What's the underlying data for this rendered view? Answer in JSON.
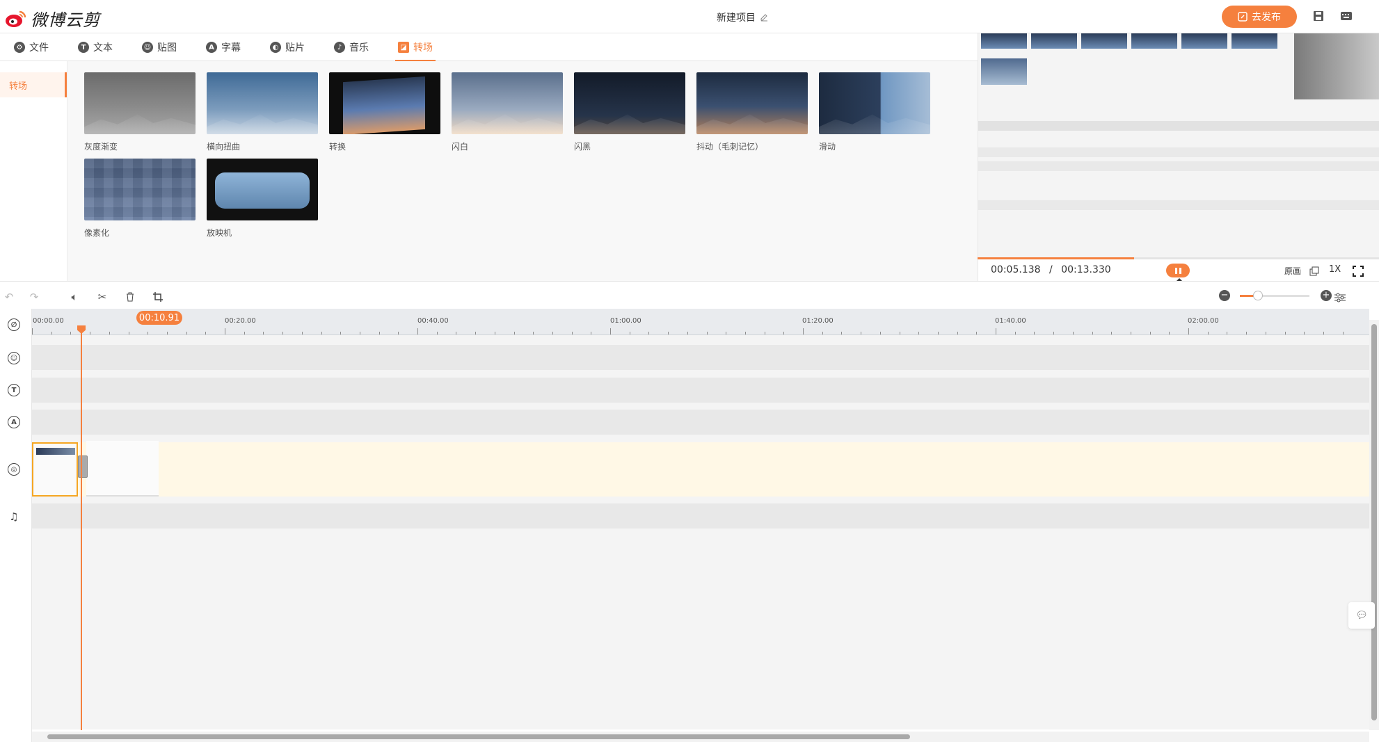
{
  "header": {
    "logo_text": "微博云剪",
    "project_title": "新建项目",
    "publish_label": "去发布"
  },
  "tabs": [
    {
      "label": "文件",
      "icon": "gear-icon"
    },
    {
      "label": "文本",
      "icon": "text-icon"
    },
    {
      "label": "贴图",
      "icon": "sticker-icon"
    },
    {
      "label": "字幕",
      "icon": "subtitle-icon"
    },
    {
      "label": "贴片",
      "icon": "patch-icon"
    },
    {
      "label": "音乐",
      "icon": "music-icon"
    },
    {
      "label": "转场",
      "icon": "transition-icon",
      "active": true
    }
  ],
  "sidebar": {
    "items": [
      {
        "label": "转场",
        "active": true
      }
    ]
  },
  "transitions": [
    {
      "label": "灰度渐变"
    },
    {
      "label": "横向扭曲"
    },
    {
      "label": "转换"
    },
    {
      "label": "闪白"
    },
    {
      "label": "闪黑"
    },
    {
      "label": "抖动（毛刺记忆）"
    },
    {
      "label": "滑动"
    },
    {
      "label": "像素化"
    },
    {
      "label": "放映机"
    }
  ],
  "preview": {
    "current_time": "00:05.138",
    "separator": "/",
    "total_time": "00:13.330",
    "progress": 0.39,
    "pause_tooltip": "暂停",
    "ratio_label": "原画",
    "speed_label": "1X"
  },
  "timeline": {
    "playhead_time": "00:10.91",
    "ruler_labels": [
      "00:00.00",
      "00:20.00",
      "00:40.00",
      "01:00.00",
      "01:20.00",
      "01:40.00",
      "02:00.00"
    ],
    "tracks": [
      "transition",
      "sticker",
      "text",
      "subtitle",
      "video",
      "music"
    ]
  },
  "colors": {
    "accent": "#f5803e",
    "video_track": "#fff8e6",
    "clip_border": "#f5a623"
  }
}
